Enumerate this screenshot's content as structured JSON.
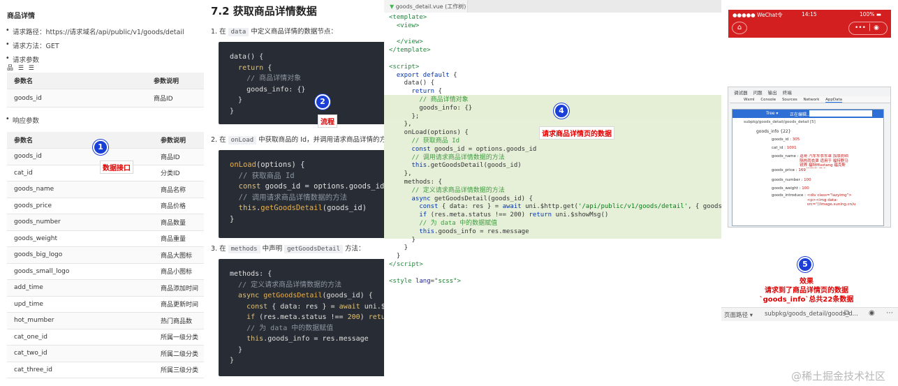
{
  "api_doc": {
    "title": "商品详情",
    "bullets": [
      "请求路径：https://请求域名/api/public/v1/goods/detail",
      "请求方法：GET",
      "请求参数"
    ],
    "toolbar": "品 ☰ ☰",
    "req_headers": [
      "参数名",
      "参数说明"
    ],
    "req_rows": [
      [
        "goods_id",
        "商品ID"
      ]
    ],
    "resp_bullet": "响应参数",
    "resp_headers": [
      "参数名",
      "参数说明"
    ],
    "resp_rows": [
      [
        "goods_id",
        "商品ID"
      ],
      [
        "cat_id",
        "分类ID"
      ],
      [
        "goods_name",
        "商品名称"
      ],
      [
        "goods_price",
        "商品价格"
      ],
      [
        "goods_number",
        "商品数量"
      ],
      [
        "goods_weight",
        "商品重量"
      ],
      [
        "goods_big_logo",
        "商品大图标"
      ],
      [
        "goods_small_logo",
        "商品小图标"
      ],
      [
        "add_time",
        "商品添加时间"
      ],
      [
        "upd_time",
        "商品更新时间"
      ],
      [
        "hot_mumber",
        "热门商品数"
      ],
      [
        "cat_one_id",
        "所属一级分类"
      ],
      [
        "cat_two_id",
        "所属二级分类"
      ],
      [
        "cat_three_id",
        "所属三级分类"
      ]
    ]
  },
  "doc": {
    "heading": "7.2 获取商品详情数据",
    "step1": {
      "pre": "1. 在",
      "code": "data",
      "post": "中定义商品详情的数据节点："
    },
    "step2": {
      "pre": "2. 在",
      "code": "onLoad",
      "post": "中获取商品的 Id，并调用请求商品详情的方"
    },
    "step3": {
      "pre": "3. 在",
      "code1": "methods",
      "mid": "中声明",
      "code2": "getGoodsDetail",
      "post": "方法："
    }
  },
  "editor": {
    "tab": "goods_detail.vue (工作树)"
  },
  "phone": {
    "carrier": "●●●●● WeChat令",
    "time": "14:15",
    "battery": "100% ▬",
    "dev_tabs": [
      "调试器",
      "问题",
      "输出",
      "终端"
    ],
    "dev_subtabs": [
      "Wxml",
      "Console",
      "Sources",
      "Network",
      "AppData"
    ],
    "tree_btn": "Tree ▾",
    "edit_btn": "正在编辑...",
    "path": "subpkg/goods_detail/goods_detail [5]",
    "goods_info": "goods_info {22}",
    "fields": [
      {
        "k": "goods_id",
        "v": "305"
      },
      {
        "k": "cat_id",
        "v": "1001"
      },
      {
        "k": "goods_name",
        "v": "逗哥 汽车车衣车罩 加厚防晒隔热雨衣罩 适用于 福特野马 锐界 福特Mustang 福克斯RS 征服者 黑色"
      },
      {
        "k": "goods_price",
        "v": "169"
      },
      {
        "k": "goods_number",
        "v": "100"
      },
      {
        "k": "goods_weight",
        "v": "100"
      },
      {
        "k": "goods_introduce",
        "v": "<div class=\"lazyimg\"><p><img data-src=\"//image.suning.cn/uimg/sop/commodity/966602987133440509...\""
      }
    ],
    "page_path_label": "页面路径 ▾",
    "page_path": "subpkg/goods_detail/goods_d..."
  },
  "annotations": {
    "n1": "1",
    "l1": "数据接口",
    "n2": "2",
    "l2": "流程",
    "n3": "4",
    "l3": "请求商品详情页的数据",
    "n4": "5",
    "l4a": "效果",
    "l4b": "请求到了商品详情页的数据",
    "l4c": "`goods_info`总共22条数据"
  },
  "watermark": "@稀土掘金技术社区"
}
